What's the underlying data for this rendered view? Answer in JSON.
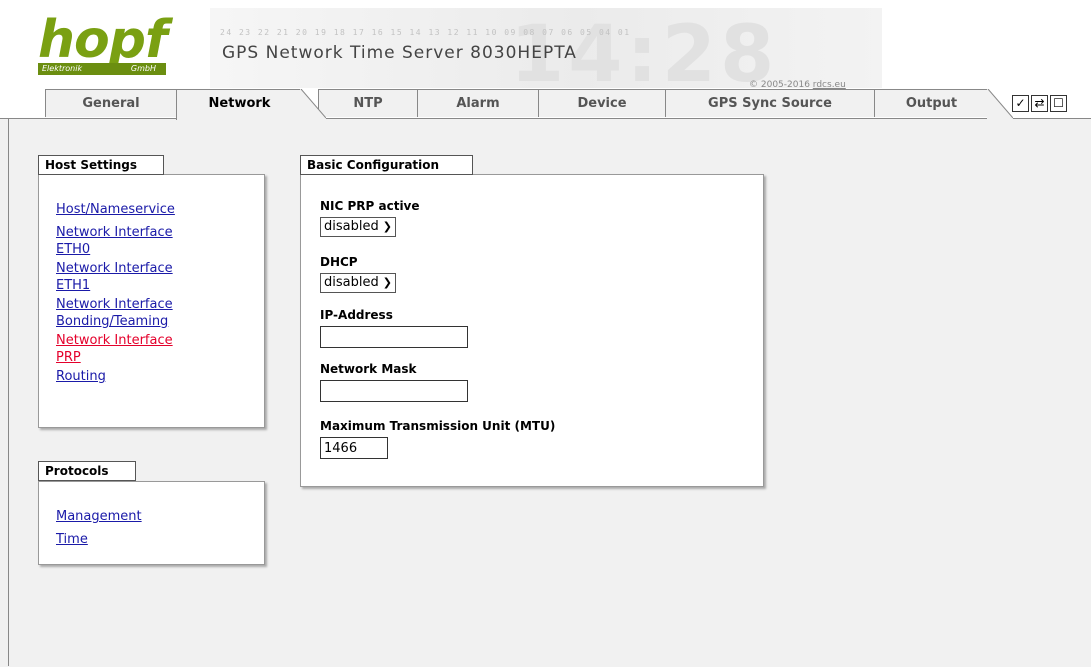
{
  "header": {
    "logo_text": "hopf",
    "logo_left": "Elektronik",
    "logo_right": "GmbH",
    "scale_numbers": "24 23 22 21 20 19 18 17 16 15 14 13 12 11 10 09 08 07 06 05 04 01",
    "product_title": "GPS Network Time Server 8030HEPTA",
    "copyright_prefix": "© 2005-2016",
    "copyright_link": "rdcs.eu"
  },
  "tabs": [
    {
      "label": "General"
    },
    {
      "label": "Network"
    },
    {
      "label": "NTP"
    },
    {
      "label": "Alarm"
    },
    {
      "label": "Device"
    },
    {
      "label": "GPS Sync Source"
    },
    {
      "label": "Output"
    }
  ],
  "toolbar": {
    "save_icon": "checkmark-icon",
    "refresh_icon": "refresh-icon",
    "window_icon": "window-icon",
    "save_glyph": "✓",
    "refresh_glyph": "⇄",
    "window_glyph": "☐"
  },
  "host_settings": {
    "title": "Host Settings",
    "links": [
      {
        "line1": "Host/Nameservice",
        "line2": ""
      },
      {
        "line1": "Network Interface",
        "line2": "ETH0"
      },
      {
        "line1": "Network Interface",
        "line2": "ETH1"
      },
      {
        "line1": "Network Interface",
        "line2": "Bonding/Teaming"
      },
      {
        "line1": "Network Interface",
        "line2": "PRP"
      },
      {
        "line1": "Routing",
        "line2": ""
      }
    ]
  },
  "protocols": {
    "title": "Protocols",
    "links": [
      "Management",
      "Time"
    ]
  },
  "basic_config": {
    "title": "Basic Configuration",
    "nic_prp": {
      "label": "NIC PRP active",
      "value": "disabled"
    },
    "dhcp": {
      "label": "DHCP",
      "value": "disabled"
    },
    "ip": {
      "label": "IP-Address",
      "value": ""
    },
    "mask": {
      "label": "Network Mask",
      "value": ""
    },
    "mtu": {
      "label": "Maximum Transmission Unit (MTU)",
      "value": "1466"
    }
  },
  "colors": {
    "link": "#1a1aa8",
    "active_link": "#e4002b",
    "logo_green": "#7aa012",
    "content_bg": "#f1f1f1"
  }
}
